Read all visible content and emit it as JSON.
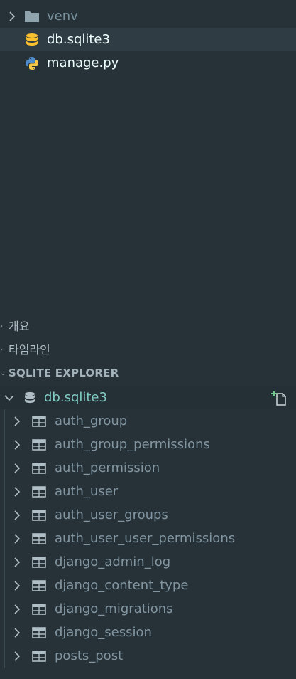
{
  "files": [
    {
      "name": "venv",
      "icon": "folder-icon",
      "expandable": true
    },
    {
      "name": "db.sqlite3",
      "icon": "database-icon",
      "selected": true
    },
    {
      "name": "manage.py",
      "icon": "python-icon"
    }
  ],
  "sections": {
    "outline": "개요",
    "timeline": "타임라인",
    "sqlite_explorer": "SQLITE EXPLORER"
  },
  "database": {
    "name": "db.sqlite3",
    "expanded": true,
    "action_icon": "new-query-icon"
  },
  "tables": [
    "auth_group",
    "auth_group_permissions",
    "auth_permission",
    "auth_user",
    "auth_user_groups",
    "auth_user_user_permissions",
    "django_admin_log",
    "django_content_type",
    "django_migrations",
    "django_session",
    "posts_post"
  ],
  "colors": {
    "background": "#263238",
    "selected_row": "#2f3c43",
    "db_accent": "#80cbc4",
    "database_icon": "#fbc02d",
    "add_icon": "#73c991"
  }
}
